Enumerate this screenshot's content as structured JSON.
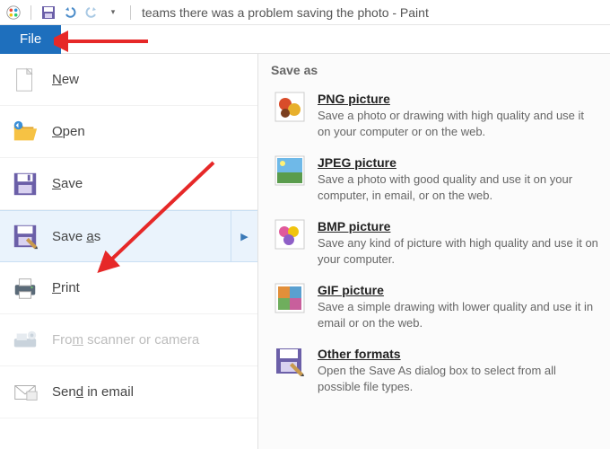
{
  "title": "teams there was a problem saving the photo - Paint",
  "file_tab": "File",
  "left_menu": {
    "new": "New",
    "open": "Open",
    "save": "Save",
    "save_as": "Save as",
    "print": "Print",
    "scanner": "From scanner or camera",
    "send_email": "Send in email"
  },
  "right": {
    "header": "Save as",
    "png": {
      "title": "PNG picture",
      "desc": "Save a photo or drawing with high quality and use it on your computer or on the web."
    },
    "jpeg": {
      "title": "JPEG picture",
      "desc": "Save a photo with good quality and use it on your computer, in email, or on the web."
    },
    "bmp": {
      "title": "BMP picture",
      "desc": "Save any kind of picture with high quality and use it on your computer."
    },
    "gif": {
      "title": "GIF picture",
      "desc": "Save a simple drawing with lower quality and use it in email or on the web."
    },
    "other": {
      "title": "Other formats",
      "desc": "Open the Save As dialog box to select from all possible file types."
    }
  }
}
